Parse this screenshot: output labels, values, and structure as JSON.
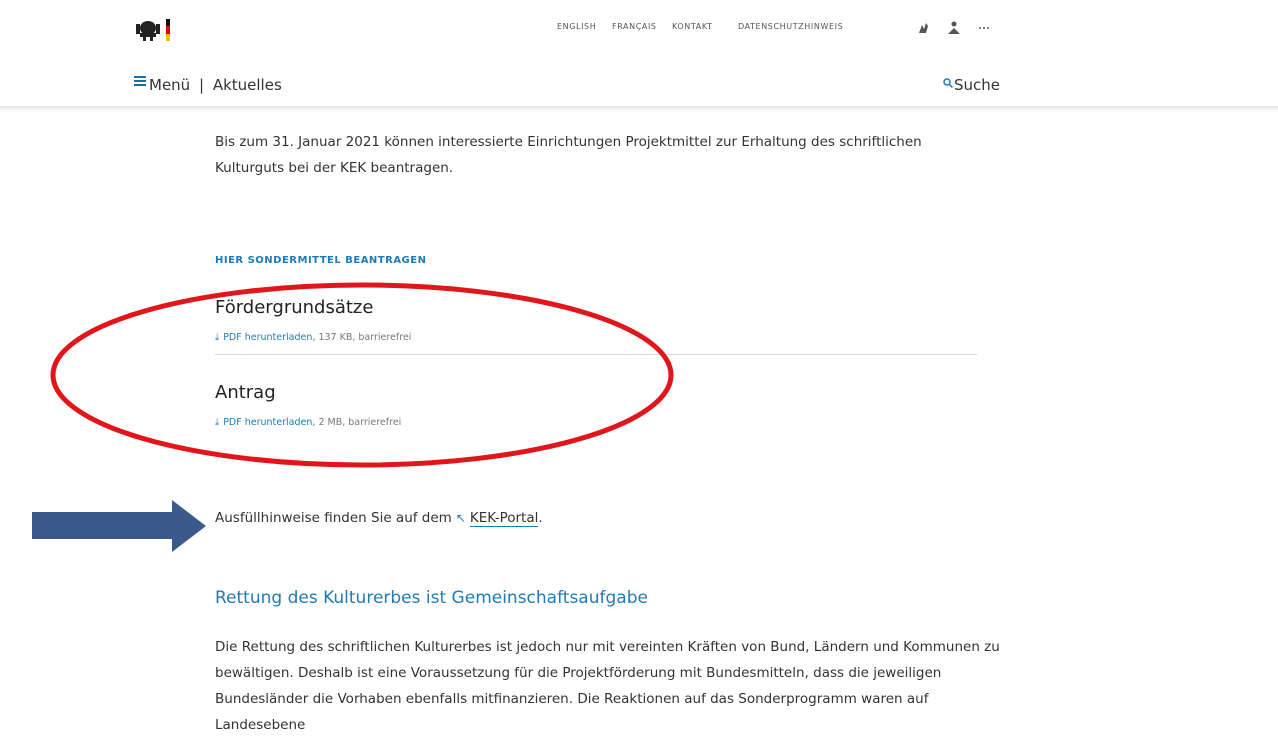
{
  "header": {
    "top_links": [
      "ENGLISH",
      "FRANÇAIS",
      "KONTAKT",
      "DATENSCHUTZHINWEIS"
    ],
    "more_icon": "ellipsis-icon",
    "menu_label": "Menü",
    "separator": "|",
    "section_label": "Aktuelles",
    "search_label": "Suche"
  },
  "intro": {
    "text": "Bis zum 31. Januar 2021 können interessierte Einrichtungen Projektmittel zur Erhaltung des schriftlichen Kulturguts bei der KEK beantragen."
  },
  "downloads": {
    "section_label": "HIER SONDERMITTEL BEANTRAGEN",
    "items": [
      {
        "title": "Fördergrundsätze",
        "link_label": "PDF herunterladen,",
        "meta": "137 KB, barrierefrei"
      },
      {
        "title": "Antrag",
        "link_label": "PDF herunterladen,",
        "meta": "2 MB, barrierefrei"
      }
    ]
  },
  "hint": {
    "text": "Ausfüllhinweise finden Sie auf dem",
    "link_label": "KEK-Portal",
    "after": "."
  },
  "section": {
    "heading": "Rettung des Kulturerbes ist Gemeinschaftsaufgabe",
    "body": "Die Rettung des schriftlichen Kulturerbes ist jedoch nur mit vereinten Kräften von Bund, Ländern und Kommunen zu bewältigen. Deshalb ist eine Voraussetzung für die Projektförderung mit Bundesmitteln, dass die jeweiligen Bundesländer die Vorhaben ebenfalls mitfinanzieren. Die Reaktionen auf das Sonderprogramm waren auf Landesebene"
  },
  "annotations": {
    "circle_color": "#e0161b",
    "arrow_color": "#3b5a8c"
  },
  "colors": {
    "accent": "#1f7bb5"
  }
}
